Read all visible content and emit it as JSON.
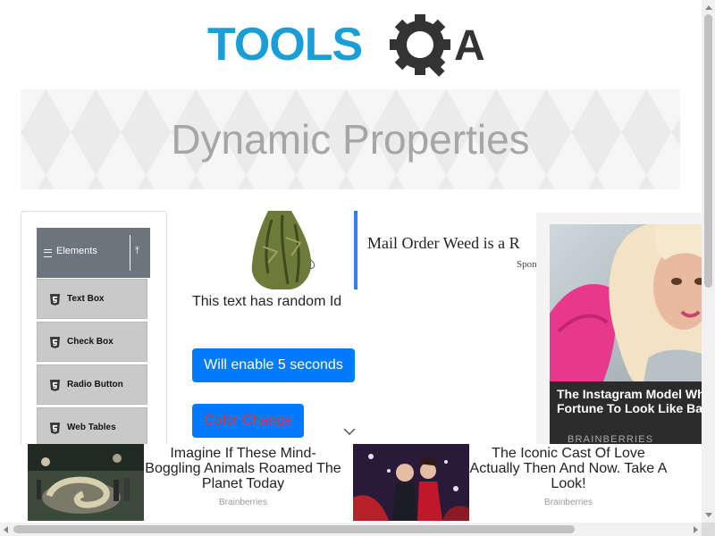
{
  "header": {
    "logo_alt": "TOOLSQA",
    "logo_text_left": "TOOLS",
    "logo_text_right": "A",
    "brand_blue": "#1a9ed8",
    "brand_dark": "#333333"
  },
  "banner": {
    "title": "Dynamic Properties"
  },
  "sidebar": {
    "group": {
      "label": "Elements",
      "icon": "menu-icon",
      "collapse_icon": "collapse-arrow-icon"
    },
    "items": [
      {
        "label": "Text Box",
        "icon": "html5-icon"
      },
      {
        "label": "Check Box",
        "icon": "html5-icon"
      },
      {
        "label": "Radio Button",
        "icon": "html5-icon"
      },
      {
        "label": "Web Tables",
        "icon": "html5-icon"
      }
    ]
  },
  "inline_ad": {
    "title": "Mail Order Weed is a R",
    "sponsor": "Spon",
    "accent": "#2b86e8"
  },
  "main": {
    "random_text": "This text has random Id",
    "enable_button": "Will enable 5 seconds",
    "color_button": "Color Change",
    "button_color": "#007bff",
    "color_button_text_color": "#dc3545"
  },
  "side_ad": {
    "headline": "The Instagram Model Who Spent A Fortune To Look Like Barbie",
    "source": "BRAINBERRIES"
  },
  "bottom_ads": [
    {
      "title": "Imagine If These Mind-Boggling Animals Roamed The Planet Today",
      "source": "Brainberries"
    },
    {
      "title": "The Iconic Cast Of Love Actually Then And Now. Take A Look!",
      "source": "Brainberries"
    }
  ]
}
